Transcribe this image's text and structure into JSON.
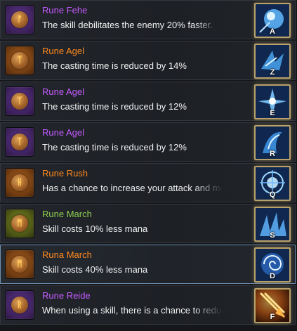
{
  "colors": {
    "purple_name": "#c45bff",
    "orange_name": "#ff8a1e",
    "green_name": "#8fd14f",
    "description": "#f1f1f1",
    "selected_border": "#6f8fb0",
    "slot_border": "#b8a16a"
  },
  "runes": [
    {
      "name": "Rune Fehe",
      "name_color": "#c45bff",
      "description": "The skill debilitates the enemy 20% faster.",
      "icon_style": "purple",
      "rune_glyph": "ᚠ",
      "hotkey": "A",
      "skill_icon": "ice-orb-icon",
      "selected": false
    },
    {
      "name": "Rune Agel",
      "name_color": "#ff8a1e",
      "description": "The casting time is reduced by 14%",
      "icon_style": "orange",
      "rune_glyph": "ᛉ",
      "hotkey": "Z",
      "skill_icon": "ice-shards-icon",
      "selected": false
    },
    {
      "name": "Rune Agel",
      "name_color": "#c45bff",
      "description": "The casting time is reduced by 12%",
      "icon_style": "purple",
      "rune_glyph": "ᛉ",
      "hotkey": "E",
      "skill_icon": "frost-burst-icon",
      "selected": false
    },
    {
      "name": "Rune Agel",
      "name_color": "#c45bff",
      "description": "The casting time is reduced by 12%",
      "icon_style": "purple",
      "rune_glyph": "ᛉ",
      "hotkey": "R",
      "skill_icon": "ice-wave-icon",
      "selected": false
    },
    {
      "name": "Rune Rush",
      "name_color": "#ff8a1e",
      "description": "Has a chance to increase your attack and movement speed.",
      "icon_style": "orange",
      "rune_glyph": "ᚺ",
      "hotkey": "Q",
      "skill_icon": "arcane-sphere-icon",
      "selected": false
    },
    {
      "name": "Rune March",
      "name_color": "#8fd14f",
      "description": "Skill costs 10% less mana",
      "icon_style": "green",
      "rune_glyph": "ᛗ",
      "hotkey": "S",
      "skill_icon": "ice-spikes-icon",
      "selected": false
    },
    {
      "name": "Runa March",
      "name_color": "#ff8a1e",
      "description": "Skill costs 40% less mana",
      "icon_style": "orange",
      "rune_glyph": "ᛗ",
      "hotkey": "D",
      "skill_icon": "frost-vortex-icon",
      "selected": true
    },
    {
      "name": "Rune Reide",
      "name_color": "#c45bff",
      "description": "When using a skill, there is a chance to reduce cooldown.",
      "icon_style": "purple",
      "rune_glyph": "ᚱ",
      "hotkey": "F",
      "skill_icon": "fire-arrow-icon",
      "selected": false
    }
  ]
}
